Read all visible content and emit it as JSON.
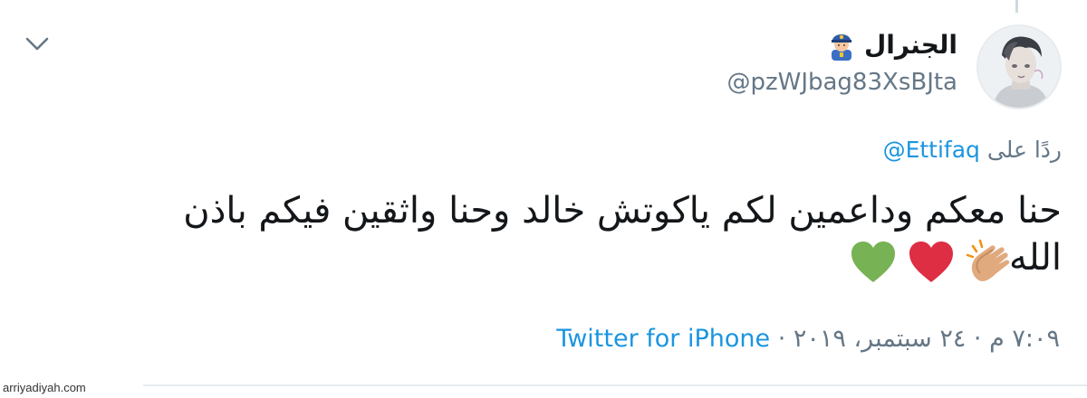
{
  "tweet": {
    "author": {
      "display_name": "الجنرال",
      "badge_icon": "police-officer-emoji-icon",
      "handle": "@pzWJbag83XsBJta"
    },
    "reply": {
      "prefix": "ردًا على",
      "to": "@Ettifaq"
    },
    "text_line1": "حنا معكم وداعمين لكم ياكوتش خالد وحنا واثقين فيكم باذن",
    "text_line2": "الله",
    "emojis": [
      "clapping-hands-icon",
      "red-heart-icon",
      "green-heart-icon"
    ],
    "timestamp": "٧:٠٩ م · ٢٤ سبتمبر، ٢٠١٩",
    "separator": " · ",
    "source": "Twitter for iPhone"
  },
  "watermark": "arriyadiyah.com",
  "colors": {
    "link": "#1b95e0",
    "secondary_text": "#657786",
    "primary_text": "#14171a"
  }
}
